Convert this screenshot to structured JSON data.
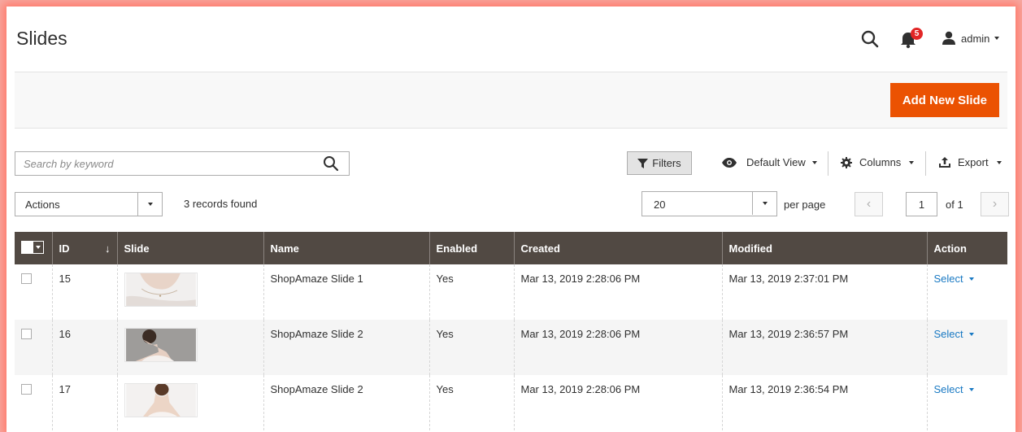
{
  "header": {
    "title": "Slides",
    "notifications_count": "5",
    "user_name": "admin"
  },
  "action_bar": {
    "add_button_label": "Add New Slide"
  },
  "toolbar": {
    "search_placeholder": "Search by keyword",
    "filters_label": "Filters",
    "view_label": "Default View",
    "columns_label": "Columns",
    "export_label": "Export",
    "actions_label": "Actions",
    "records_found": "3 records found",
    "per_page_value": "20",
    "per_page_label": "per page",
    "current_page": "1",
    "total_pages_label": "of 1"
  },
  "grid": {
    "columns": [
      "ID",
      "Slide",
      "Name",
      "Enabled",
      "Created",
      "Modified",
      "Action"
    ],
    "rows": [
      {
        "id": "15",
        "name": "ShopAmaze Slide 1",
        "enabled": "Yes",
        "created": "Mar 13, 2019 2:28:06 PM",
        "modified": "Mar 13, 2019 2:37:01 PM",
        "action": "Select"
      },
      {
        "id": "16",
        "name": "ShopAmaze Slide 2",
        "enabled": "Yes",
        "created": "Mar 13, 2019 2:28:06 PM",
        "modified": "Mar 13, 2019 2:36:57 PM",
        "action": "Select"
      },
      {
        "id": "17",
        "name": "ShopAmaze Slide 2",
        "enabled": "Yes",
        "created": "Mar 13, 2019 2:28:06 PM",
        "modified": "Mar 13, 2019 2:36:54 PM",
        "action": "Select"
      }
    ]
  },
  "colors": {
    "accent": "#eb5202",
    "grid_header": "#514943",
    "link": "#1979c3",
    "badge": "#e22626"
  },
  "icons": {
    "search": "magnifier-icon",
    "notifications": "bell-icon",
    "user": "user-icon",
    "filters": "funnel-icon",
    "view": "eye-icon",
    "columns": "gear-icon",
    "export": "export-icon"
  }
}
